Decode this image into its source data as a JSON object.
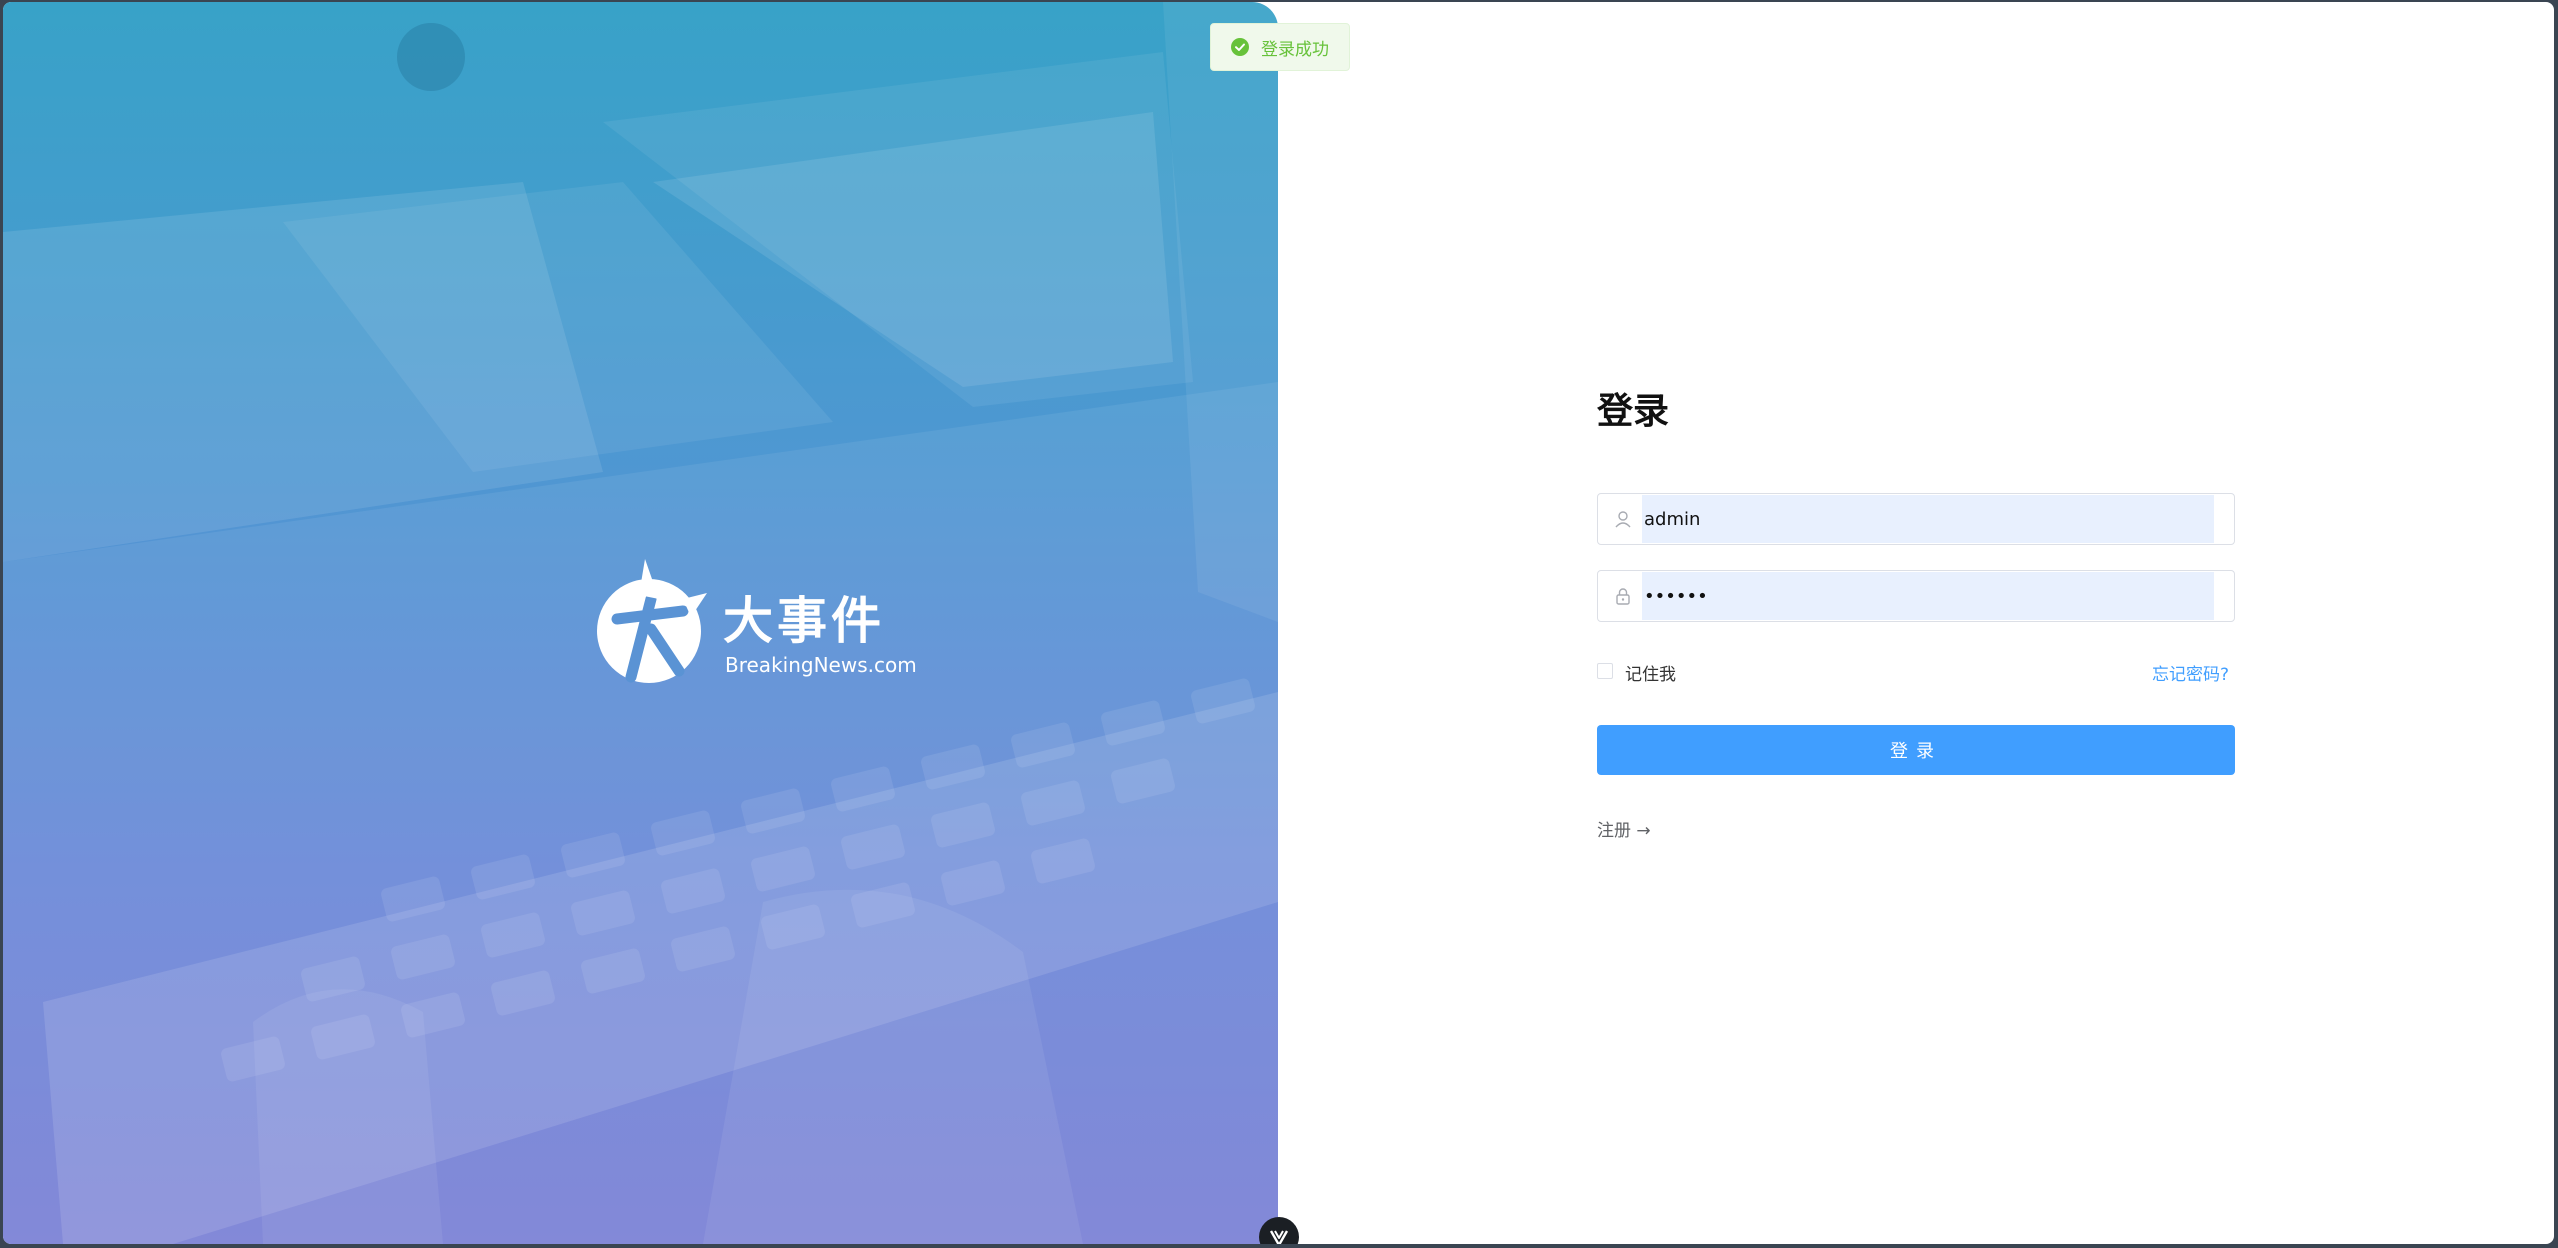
{
  "toast": {
    "message": "登录成功",
    "icon": "check-circle-icon",
    "color": "#67c23a"
  },
  "hero": {
    "logo_title": "大事件",
    "logo_subtitle": "BreakingNews.com"
  },
  "login_form": {
    "title": "登录",
    "username": {
      "value": "admin",
      "icon": "user-icon"
    },
    "password": {
      "value": "123456",
      "icon": "lock-icon"
    },
    "remember_label": "记住我",
    "forgot_label": "忘记密码?",
    "submit_label": "登录",
    "register_label": "注册 →"
  },
  "colors": {
    "primary": "#409eff",
    "success": "#67c23a",
    "autofill": "#e8f0fe",
    "hero_top": "#38a2c8",
    "hero_bottom": "#7a80d6"
  }
}
